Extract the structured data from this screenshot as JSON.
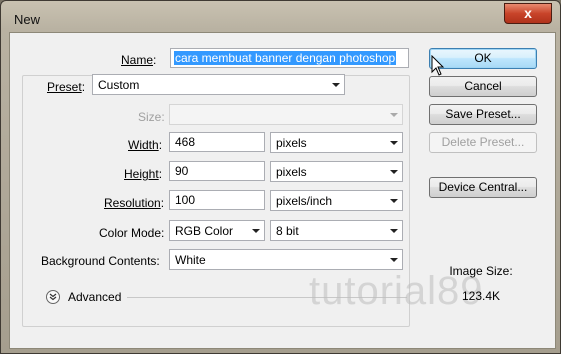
{
  "window": {
    "title": "New",
    "close_glyph": "x"
  },
  "form": {
    "name_label": "Name",
    "name_value": "cara membuat banner dengan photoshop",
    "preset_label": "Preset",
    "preset_value": "Custom",
    "size_label": "Size",
    "size_value": "",
    "width_label": "Width",
    "width_value": "468",
    "width_unit": "pixels",
    "height_label": "Height",
    "height_value": "90",
    "height_unit": "pixels",
    "resolution_label": "Resolution",
    "resolution_value": "100",
    "resolution_unit": "pixels/inch",
    "color_mode_label": "Color Mode",
    "color_mode_value": "RGB Color",
    "bit_depth_value": "8 bit",
    "background_label": "Background Contents",
    "background_value": "White",
    "advanced_label": "Advanced"
  },
  "buttons": {
    "ok": "OK",
    "cancel": "Cancel",
    "save_preset": "Save Preset...",
    "delete_preset": "Delete Preset...",
    "device_central": "Device Central..."
  },
  "image_size": {
    "label": "Image Size:",
    "value": "123.4K"
  },
  "watermark": "tutorial89",
  "icons": [
    "close-icon",
    "dropdown-arrow-icon",
    "expand-chevron-icon",
    "mouse-cursor-icon"
  ]
}
